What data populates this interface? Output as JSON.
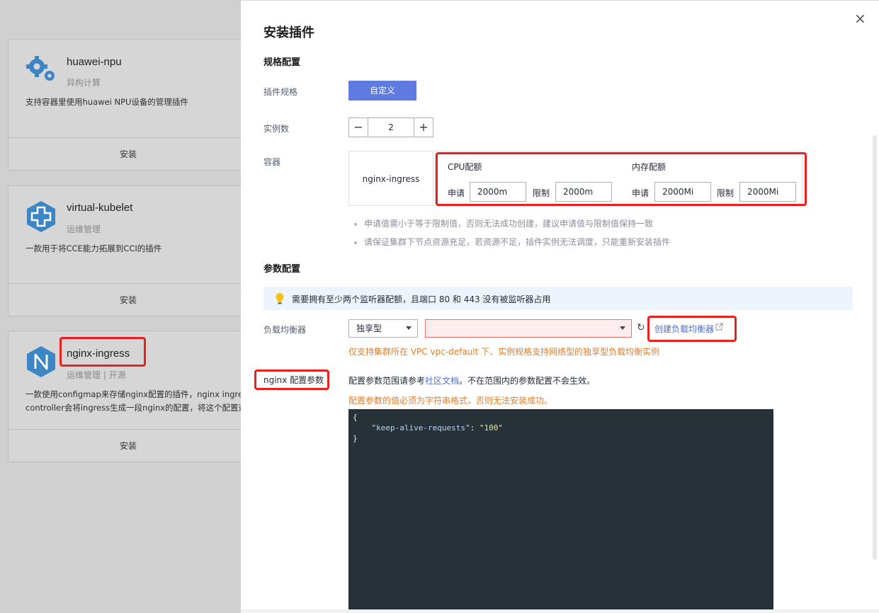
{
  "background": {
    "cards": [
      {
        "name": "huawei-npu",
        "category": "异构计算",
        "desc": "支持容器里使用huawei NPU设备的管理插件",
        "install": "安装"
      },
      {
        "name": "virtual-kubelet",
        "category": "运维管理",
        "desc": "一款用于将CCE能力拓展到CCI的插件",
        "install": "安装"
      },
      {
        "name": "nginx-ingress",
        "category": "运维管理 | 开源",
        "desc_line1": "一款使用configmap来存储nginx配置的插件，nginx ingress",
        "desc_line2": "controller会将ingress生成一段nginx的配置，将这个配置通",
        "install": "安装"
      }
    ]
  },
  "drawer": {
    "title": "安装插件",
    "close": "×",
    "spec_section": "规格配置",
    "plugin_spec_label": "插件规格",
    "plugin_spec_button": "自定义",
    "instance_label": "实例数",
    "instance_minus": "−",
    "instance_value": "2",
    "instance_plus": "+",
    "container_label": "容器",
    "container_name": "nginx-ingress",
    "cpu_title": "CPU配额",
    "mem_title": "内存配额",
    "request_label": "申请",
    "limit_label": "限制",
    "cpu_request": "2000m",
    "cpu_limit": "2000m",
    "mem_request": "2000Mi",
    "mem_limit": "2000Mi",
    "tips": [
      "申请值需小于等于限制值，否则无法成功创建，建议申请值与限制值保持一致",
      "请保证集群下节点资源充足，若资源不足，插件实例无法调度，只能重新安装插件"
    ],
    "param_section": "参数配置",
    "alert_text": "需要拥有至少两个监听器配额，且端口 80 和 443 没有被监听器占用",
    "lb_label": "负载均衡器",
    "lb_type": "独享型",
    "lb_value": "",
    "lb_create_link": "创建负载均衡器",
    "lb_warning": "仅支持集群所在 VPC vpc-default 下、实例规格支持网络型的独享型负载均衡实例",
    "nginx_param_label": "nginx 配置参数",
    "note_prefix": "配置参数范围请参考",
    "note_link": "社区文档",
    "note_suffix": "。不在范围内的参数配置不会生效。",
    "string_warning": "配置参数的值必须为字符串格式，否则无法安装成功。",
    "code": {
      "open": "{",
      "key": "\"keep-alive-requests\"",
      "colon": ": ",
      "value": "\"100\"",
      "close": "}"
    }
  },
  "colors": {
    "primary": "#5e7ce0",
    "highlight": "#e8201e",
    "warning": "#e37d29",
    "link": "#526ecc"
  }
}
